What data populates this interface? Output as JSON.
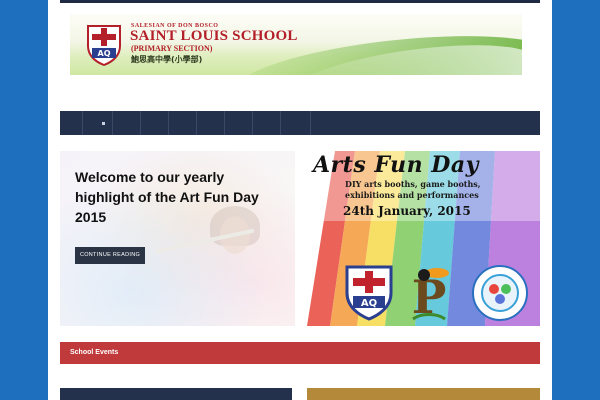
{
  "banner": {
    "small_line": "SALESIAN OF DON BOSCO",
    "title": "SAINT LOUIS SCHOOL",
    "subtitle": "(PRIMARY SECTION)",
    "chinese": "鮑思高中學(小學部)",
    "crest_letters": "AQ",
    "crest_motto": "SALVATOR ET PATRUS"
  },
  "nav": {
    "active_marker": "home"
  },
  "slider": {
    "heading": "Welcome to our yearly highlight of the Art Fun Day 2015",
    "button_label": "CONTINUE READING",
    "poster": {
      "title": "Arts Fun Day",
      "line1": "DIY arts booths, game booths,",
      "line2": "exhibitions and performances",
      "date": "24th January, 2015",
      "logo1_letters": "AQ",
      "logo2_letter": "P"
    }
  },
  "events": {
    "label": "School Events"
  },
  "colors": {
    "background": "#1f6fbf",
    "nav": "#24314d",
    "events": "#c0393b",
    "accent_gold": "#b48a3a",
    "brand_red": "#b3202a"
  }
}
